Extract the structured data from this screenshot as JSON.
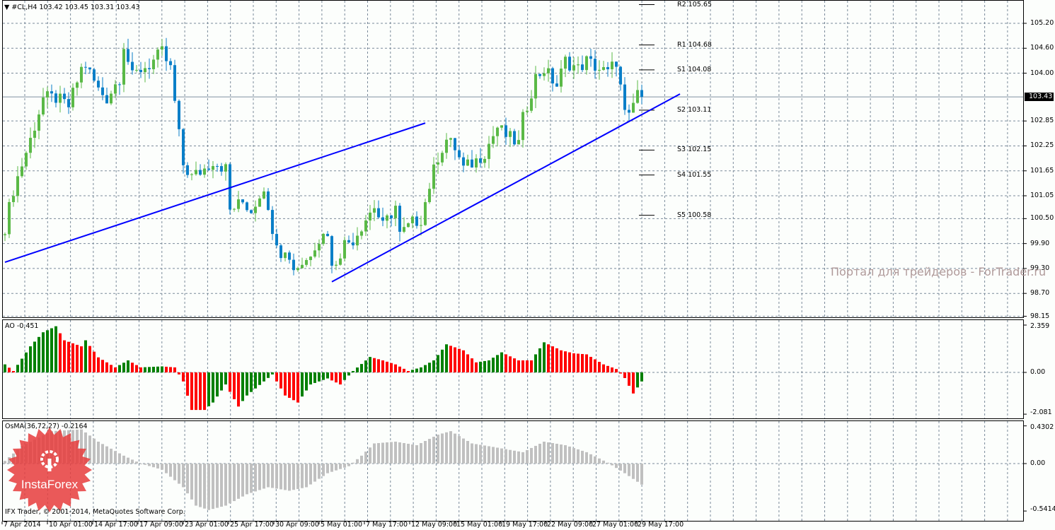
{
  "header": {
    "symbol": "#CL,H4",
    "ohlc": "103.42 103.45 103.31 103.43"
  },
  "watermark": "Портал для трейдеров - ForTrader.ru",
  "copyright": "IFX Trader, © 2001-2014, MetaQuotes Software Corp.",
  "logo_text": "InstaForex",
  "colors": {
    "bull": "#5ab946",
    "bear": "#0a7fc8",
    "ao_up": "#008000",
    "ao_down": "#ff0000",
    "osma": "#c0c0c0",
    "trend": "#0000ff",
    "grid": "#7a8a9a",
    "bg": "#fcfefc"
  },
  "chart_data": [
    {
      "type": "candlestick",
      "title": "#CL,H4",
      "current_price": "103.43",
      "ylim": [
        98.15,
        105.65
      ],
      "yticks": [
        "105.20",
        "104.60",
        "104.00",
        "102.85",
        "102.25",
        "101.65",
        "101.05",
        "100.50",
        "99.90",
        "99.30",
        "98.70",
        "98.15"
      ],
      "xticks": [
        "7 Apr 2014",
        "10 Apr 01:00",
        "14 Apr 17:00",
        "17 Apr 09:00",
        "23 Apr 01:00",
        "25 Apr 17:00",
        "30 Apr 09:00",
        "5 May 01:00",
        "7 May 17:00",
        "12 May 09:00",
        "15 May 01:00",
        "19 May 17:00",
        "22 May 09:00",
        "27 May 01:00",
        "29 May 17:00"
      ],
      "bars": 151,
      "close_keypoints": [
        [
          0,
          100.3
        ],
        [
          2,
          101.2
        ],
        [
          6,
          102.4
        ],
        [
          9,
          103.4
        ],
        [
          12,
          103.4
        ],
        [
          15,
          103.2
        ],
        [
          18,
          104.1
        ],
        [
          19,
          104.2
        ],
        [
          22,
          103.6
        ],
        [
          24,
          103.4
        ],
        [
          27,
          103.9
        ],
        [
          28,
          104.7
        ],
        [
          30,
          103.9
        ],
        [
          32,
          104.1
        ],
        [
          34,
          104.2
        ],
        [
          37,
          104.5
        ],
        [
          39,
          104.1
        ],
        [
          41,
          102.5
        ],
        [
          42,
          101.8
        ],
        [
          44,
          101.5
        ],
        [
          47,
          101.7
        ],
        [
          49,
          101.9
        ],
        [
          52,
          101.7
        ],
        [
          53,
          100.7
        ],
        [
          56,
          100.9
        ],
        [
          58,
          100.7
        ],
        [
          61,
          101.3
        ],
        [
          62,
          100.6
        ],
        [
          65,
          99.7
        ],
        [
          67,
          99.6
        ],
        [
          68,
          99.3
        ],
        [
          71,
          99.5
        ],
        [
          73,
          99.9
        ],
        [
          76,
          100.2
        ],
        [
          77,
          99.3
        ],
        [
          80,
          99.9
        ],
        [
          82,
          100.0
        ],
        [
          85,
          100.5
        ],
        [
          87,
          100.8
        ],
        [
          89,
          100.3
        ],
        [
          92,
          100.8
        ],
        [
          93,
          100.1
        ],
        [
          96,
          100.4
        ],
        [
          98,
          100.5
        ],
        [
          100,
          101.3
        ],
        [
          102,
          102.0
        ],
        [
          104,
          102.4
        ],
        [
          106,
          102.2
        ],
        [
          108,
          101.7
        ],
        [
          111,
          101.9
        ],
        [
          113,
          102.1
        ],
        [
          116,
          102.7
        ],
        [
          118,
          102.5
        ],
        [
          121,
          102.3
        ],
        [
          122,
          102.9
        ],
        [
          125,
          103.9
        ],
        [
          127,
          104.1
        ],
        [
          130,
          103.7
        ],
        [
          132,
          104.3
        ],
        [
          135,
          104.1
        ],
        [
          137,
          104.3
        ],
        [
          140,
          104.1
        ],
        [
          142,
          104.0
        ],
        [
          144,
          104.3
        ],
        [
          146,
          103.0
        ],
        [
          147,
          102.9
        ],
        [
          149,
          103.6
        ],
        [
          150,
          103.43
        ]
      ],
      "trendlines": [
        [
          [
            0,
            99.45
          ],
          [
            99,
            102.8
          ]
        ],
        [
          [
            77,
            98.98
          ],
          [
            159,
            103.5
          ]
        ]
      ],
      "pivots": [
        {
          "label": "R2 105.65",
          "value": 105.65
        },
        {
          "label": "R1 104.68",
          "value": 104.68
        },
        {
          "label": "S1 104.08",
          "value": 104.08
        },
        {
          "label": "S2 103.11",
          "value": 103.11
        },
        {
          "label": "S3 102.15",
          "value": 102.15
        },
        {
          "label": "S4 101.55",
          "value": 101.55
        },
        {
          "label": "S5 100.58",
          "value": 100.58
        }
      ]
    },
    {
      "type": "bar",
      "title": "AO -0,451",
      "ylim": [
        -2.081,
        2.359
      ],
      "yticks": [
        "2.359",
        "0.00",
        "-2.081"
      ],
      "keypoints": [
        [
          0,
          0.4
        ],
        [
          2,
          0.07
        ],
        [
          6,
          1.3
        ],
        [
          9,
          2.0
        ],
        [
          12,
          2.3
        ],
        [
          14,
          1.6
        ],
        [
          18,
          1.3
        ],
        [
          19,
          1.6
        ],
        [
          22,
          0.75
        ],
        [
          26,
          0.25
        ],
        [
          29,
          0.6
        ],
        [
          32,
          0.25
        ],
        [
          37,
          0.3
        ],
        [
          40,
          0.25
        ],
        [
          42,
          -0.45
        ],
        [
          44,
          -1.87
        ],
        [
          47,
          -1.87
        ],
        [
          49,
          -1.5
        ],
        [
          52,
          -0.6
        ],
        [
          55,
          -1.7
        ],
        [
          57,
          -1.15
        ],
        [
          61,
          -0.45
        ],
        [
          63,
          -0.1
        ],
        [
          66,
          -1.15
        ],
        [
          69,
          -1.5
        ],
        [
          72,
          -0.6
        ],
        [
          76,
          -0.3
        ],
        [
          79,
          -0.6
        ],
        [
          82,
          0.07
        ],
        [
          86,
          0.77
        ],
        [
          89,
          0.6
        ],
        [
          92,
          0.4
        ],
        [
          95,
          0.07
        ],
        [
          98,
          0.25
        ],
        [
          101,
          0.6
        ],
        [
          104,
          1.4
        ],
        [
          108,
          1.1
        ],
        [
          111,
          0.5
        ],
        [
          114,
          0.6
        ],
        [
          117,
          1.0
        ],
        [
          121,
          0.6
        ],
        [
          124,
          0.6
        ],
        [
          127,
          1.5
        ],
        [
          131,
          1.1
        ],
        [
          134,
          0.95
        ],
        [
          137,
          0.9
        ],
        [
          141,
          0.4
        ],
        [
          144,
          0.17
        ],
        [
          146,
          -0.28
        ],
        [
          148,
          -1.05
        ],
        [
          150,
          -0.45
        ]
      ]
    },
    {
      "type": "bar",
      "title": "OsMA(36,72,27) -0.2164",
      "ylim": [
        -0.5414,
        0.4302
      ],
      "yticks": [
        "0.4302",
        "0.00",
        "-0.5414"
      ],
      "keypoints": [
        [
          0,
          0.03
        ],
        [
          4,
          0.2
        ],
        [
          11,
          0.37
        ],
        [
          18,
          0.39
        ],
        [
          22,
          0.25
        ],
        [
          28,
          0.09
        ],
        [
          32,
          0
        ],
        [
          37,
          -0.07
        ],
        [
          42,
          -0.27
        ],
        [
          45,
          -0.48
        ],
        [
          48,
          -0.53
        ],
        [
          52,
          -0.48
        ],
        [
          57,
          -0.35
        ],
        [
          62,
          -0.27
        ],
        [
          67,
          -0.31
        ],
        [
          71,
          -0.27
        ],
        [
          76,
          -0.11
        ],
        [
          81,
          -0.03
        ],
        [
          84,
          0.09
        ],
        [
          87,
          0.23
        ],
        [
          92,
          0.25
        ],
        [
          97,
          0.21
        ],
        [
          102,
          0.33
        ],
        [
          105,
          0.37
        ],
        [
          110,
          0.23
        ],
        [
          115,
          0.19
        ],
        [
          122,
          0.13
        ],
        [
          127,
          0.25
        ],
        [
          132,
          0.21
        ],
        [
          137,
          0.13
        ],
        [
          142,
          0.01
        ],
        [
          146,
          -0.11
        ],
        [
          150,
          -0.24
        ]
      ]
    }
  ]
}
